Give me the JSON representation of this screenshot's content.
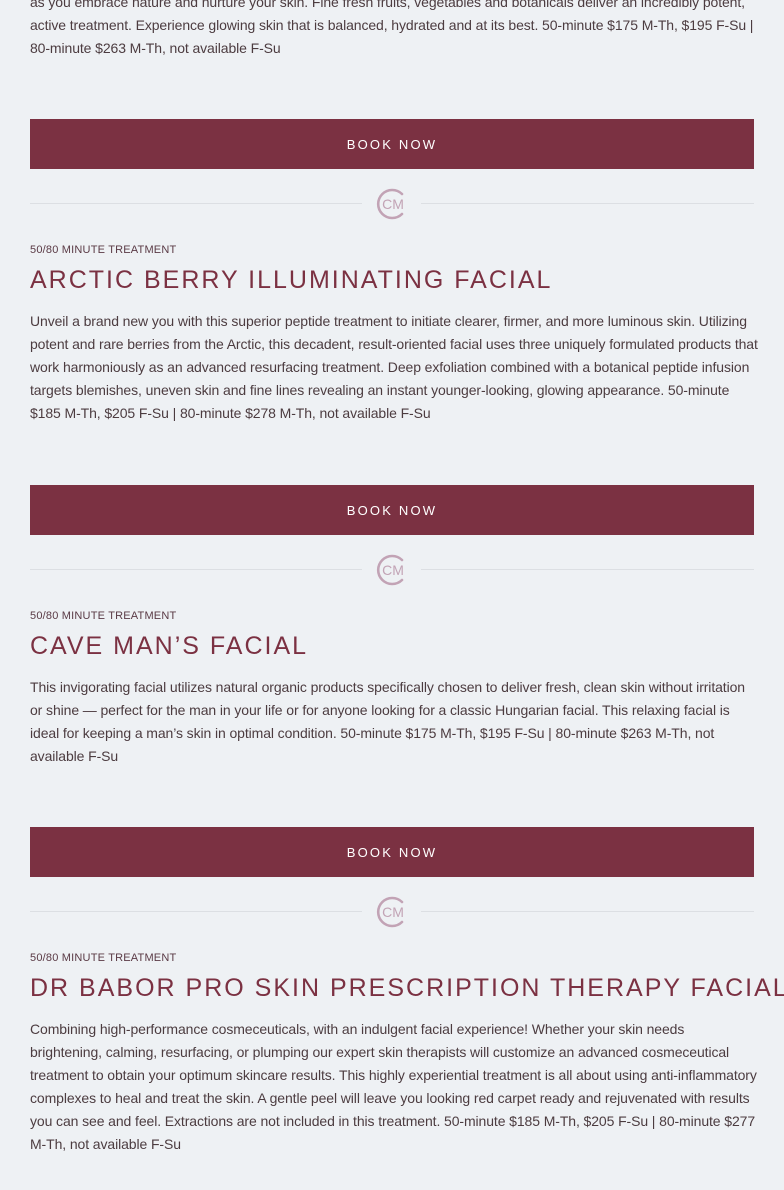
{
  "top": {
    "description_tail": "as you embrace nature and nurture your skin. Fine fresh fruits, vegetables and botanicals deliver an incredibly potent, active treatment. Experience glowing skin that is balanced, hydrated and at its best. 50-minute $175 M-Th, $195 F-Su | 80-minute $263 M-Th, not available F-Su",
    "book_label": "Book Now"
  },
  "logo_text": "CM",
  "treatments": [
    {
      "kicker": "50/80 Minute Treatment",
      "title": "Arctic Berry Illuminating Facial",
      "description": "Unveil a brand new you with this superior peptide treatment to initiate clearer, firmer, and more luminous skin. Utilizing potent and rare berries from the Arctic, this decadent, result-oriented facial uses three uniquely formulated products that work harmoniously as an advanced resurfacing treatment. Deep exfoliation combined with a botanical peptide infusion targets blemishes, uneven skin and fine lines revealing an instant younger-looking, glowing appearance. 50-minute $185 M-Th, $205 F-Su | 80-minute $278 M-Th, not available F-Su",
      "book_label": "Book Now"
    },
    {
      "kicker": "50/80 Minute Treatment",
      "title": "Cave Man’s Facial",
      "description": "This invigorating facial utilizes natural organic products specifically chosen to deliver fresh, clean skin without irritation or shine — perfect for the man in your life or for anyone looking for a classic Hungarian facial. This relaxing facial is ideal for keeping a man’s skin in optimal condition. 50-minute $175 M-Th, $195 F-Su | 80-minute $263 M-Th, not available F-Su",
      "book_label": "Book Now"
    },
    {
      "kicker": "50/80 Minute Treatment",
      "title": "Dr Babor Pro Skin Prescription Therapy Facial",
      "description": "Combining high-performance cosmeceuticals, with an indulgent facial experience! Whether your skin needs brightening, calming, resurfacing, or plumping our expert skin therapists will customize an advanced cosmeceutical treatment to obtain your optimum skincare results. This highly experiential treatment is all about using anti-inflammatory complexes to heal and treat the skin. A gentle peel will leave you looking red carpet ready and rejuvenated with results you can see and feel. Extractions are not included in this treatment. 50-minute $185 M-Th, $205 F-Su | 80-minute $277 M-Th, not available F-Su"
    }
  ],
  "colors": {
    "accent": "#7b3142",
    "background": "#eef1f4",
    "logo": "#c2a3b5"
  }
}
